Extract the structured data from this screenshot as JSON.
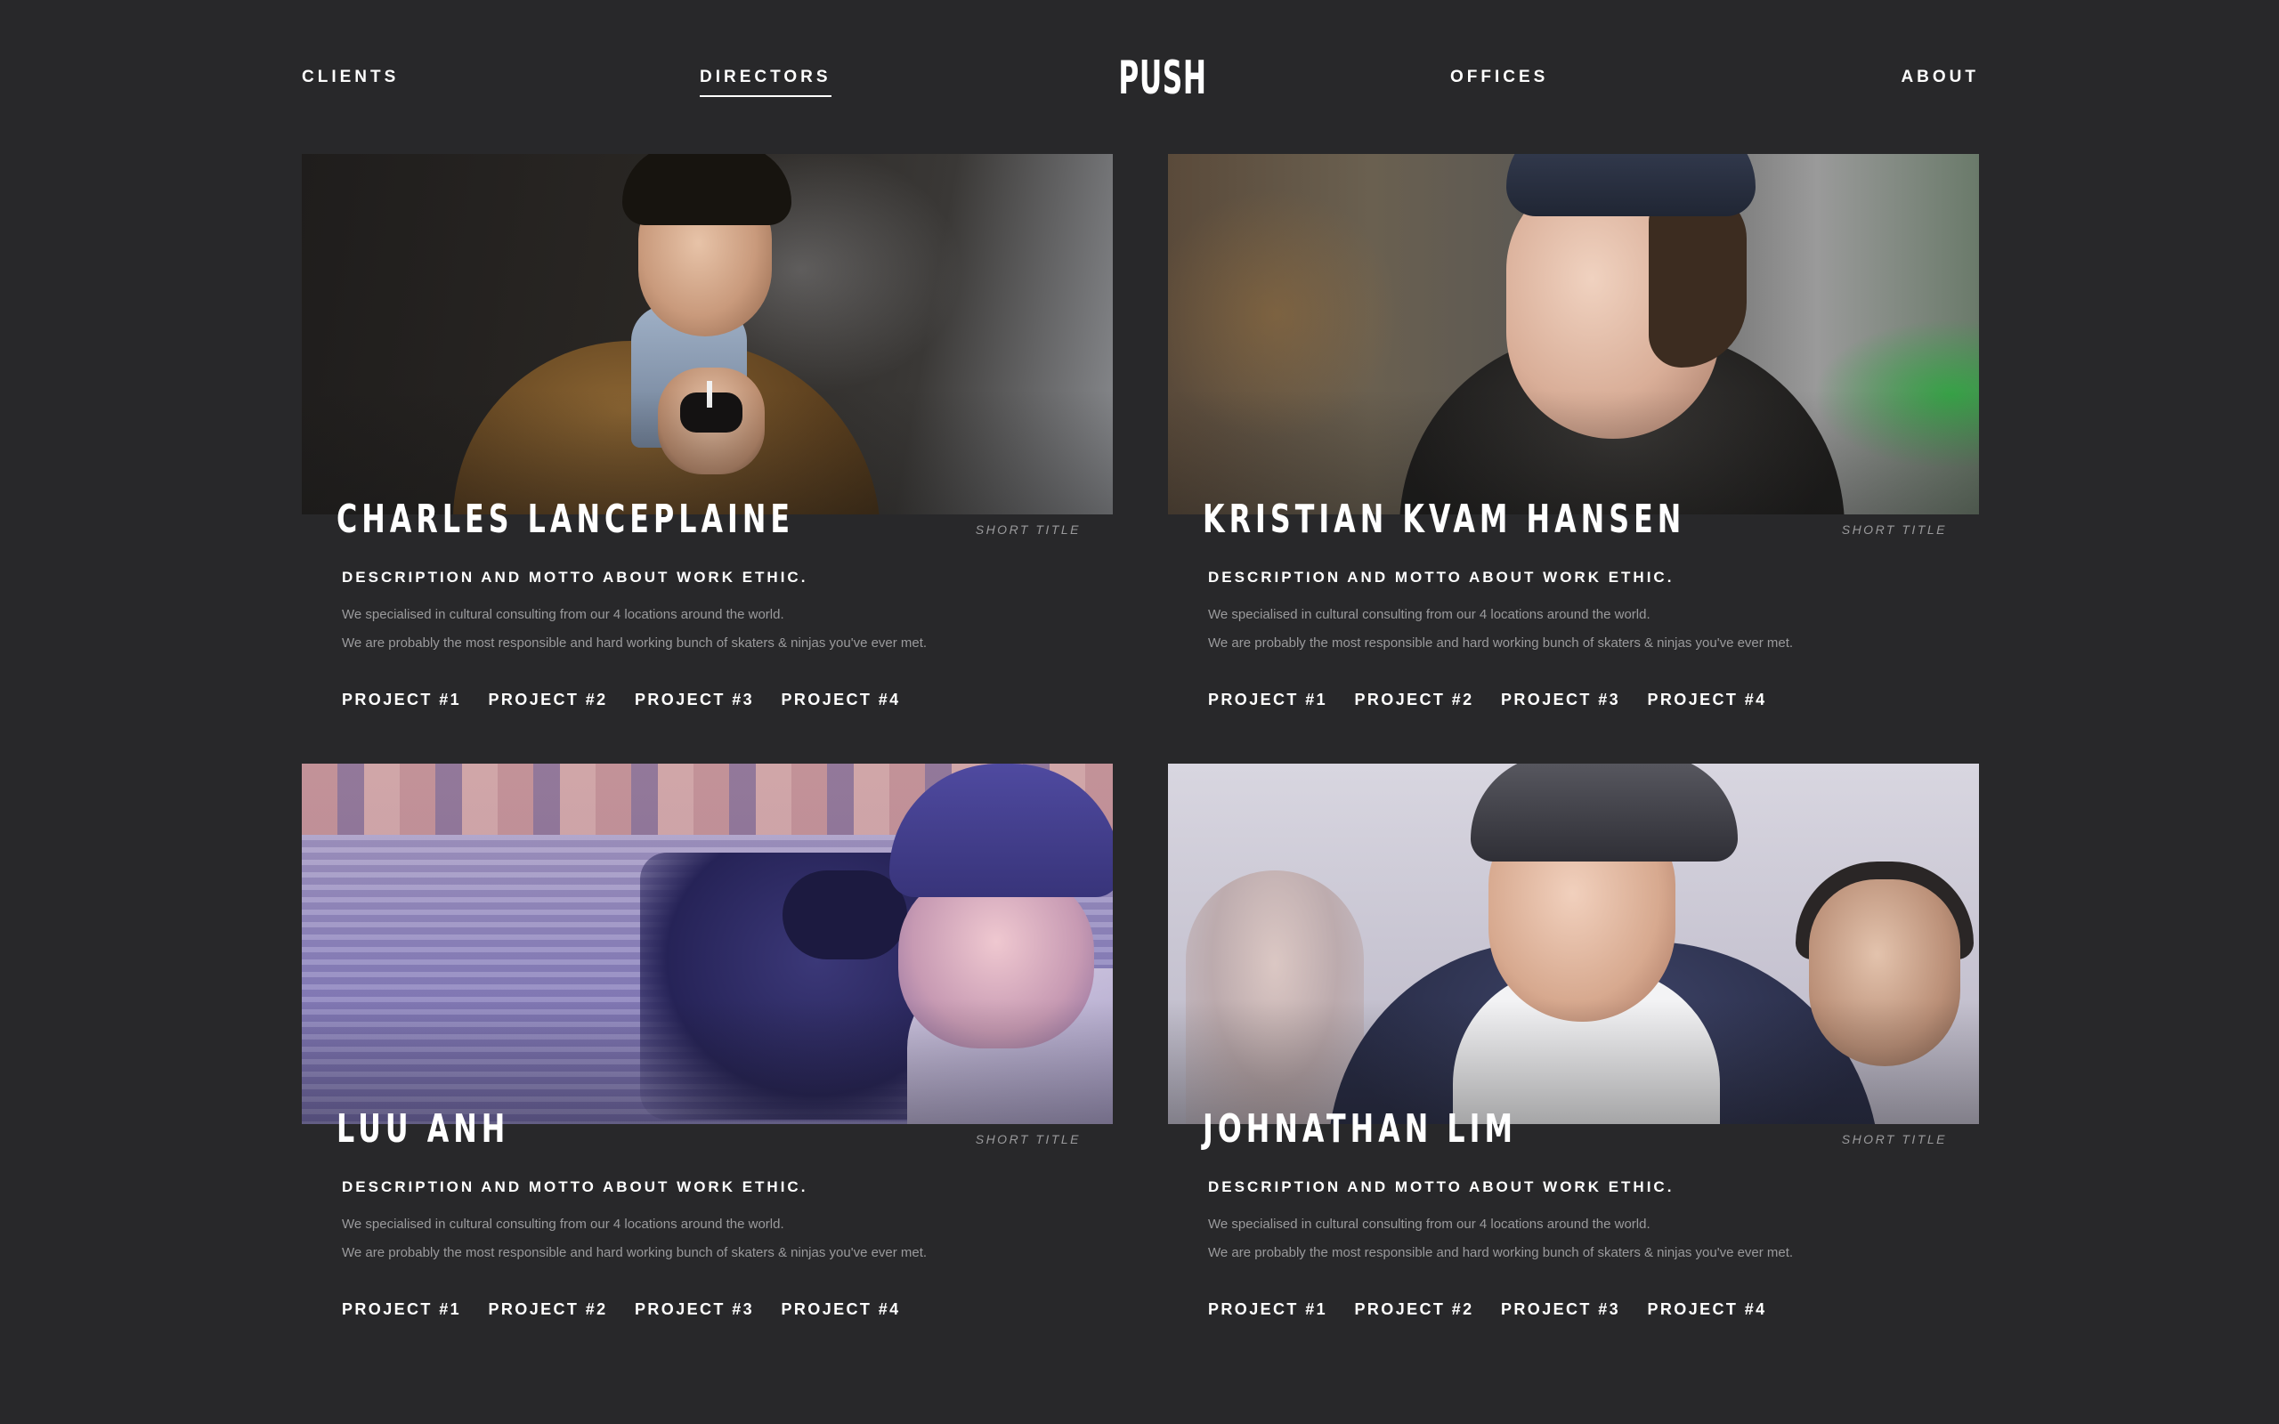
{
  "nav": {
    "clients": "CLIENTS",
    "directors": "DIRECTORS",
    "logo": "PUSH",
    "offices": "OFFICES",
    "about": "ABOUT",
    "active": "directors"
  },
  "directors": [
    {
      "name": "CHARLES LANCEPLAINE",
      "short_title": "SHORT TITLE",
      "motto": "DESCRIPTION AND MOTTO ABOUT WORK ETHIC.",
      "description_1": "We specialised in cultural consulting from our 4 locations around the world.",
      "description_2": "We are probably the most responsible and hard working bunch of skaters & ninjas you've ever met.",
      "projects": [
        "PROJECT #1",
        "PROJECT #2",
        "PROJECT #3",
        "PROJECT #4"
      ]
    },
    {
      "name": "KRISTIAN KVAM HANSEN",
      "short_title": "SHORT TITLE",
      "motto": "DESCRIPTION AND MOTTO ABOUT WORK ETHIC.",
      "description_1": "We specialised in cultural consulting from our 4 locations around the world.",
      "description_2": "We are probably the most responsible and hard working bunch of skaters & ninjas you've ever met.",
      "projects": [
        "PROJECT #1",
        "PROJECT #2",
        "PROJECT #3",
        "PROJECT #4"
      ]
    },
    {
      "name": "LUU ANH",
      "short_title": "SHORT TITLE",
      "motto": "DESCRIPTION AND MOTTO ABOUT WORK ETHIC.",
      "description_1": "We specialised in cultural consulting from our 4 locations around the world.",
      "description_2": "We are probably the most responsible and hard working bunch of skaters & ninjas you've ever met.",
      "projects": [
        "PROJECT #1",
        "PROJECT #2",
        "PROJECT #3",
        "PROJECT #4"
      ]
    },
    {
      "name": "JOHNATHAN LIM",
      "short_title": "SHORT TITLE",
      "motto": "DESCRIPTION AND MOTTO ABOUT WORK ETHIC.",
      "description_1": "We specialised in cultural consulting from our 4 locations around the world.",
      "description_2": "We are probably the most responsible and hard working bunch of skaters & ninjas you've ever met.",
      "projects": [
        "PROJECT #1",
        "PROJECT #2",
        "PROJECT #3",
        "PROJECT #4"
      ]
    }
  ],
  "colors": {
    "background": "#28282a",
    "text": "#ffffff",
    "muted_text": "#9a9a9c"
  }
}
